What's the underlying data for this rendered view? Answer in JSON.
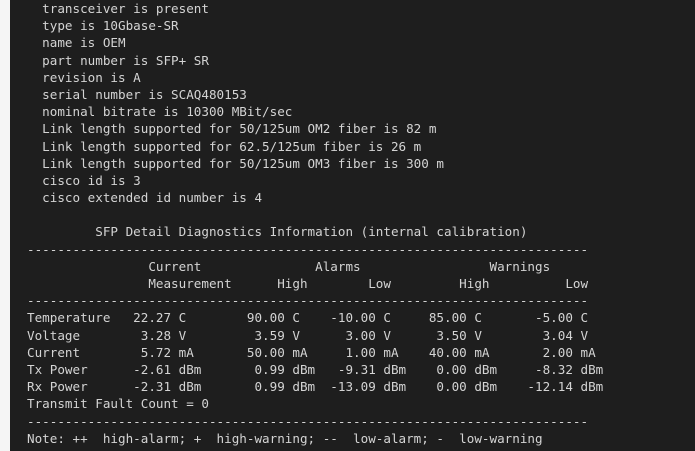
{
  "terminal": {
    "lines": [
      "  transceiver is present",
      "  type is 10Gbase-SR",
      "  name is OEM",
      "  part number is SFP+ SR",
      "  revision is A",
      "  serial number is SCAQ480153",
      "  nominal bitrate is 10300 MBit/sec",
      "  Link length supported for 50/125um OM2 fiber is 82 m",
      "  Link length supported for 62.5/125um fiber is 26 m",
      "  Link length supported for 50/125um OM3 fiber is 300 m",
      "  cisco id is 3",
      "  cisco extended id number is 4",
      "",
      "         SFP Detail Diagnostics Information (internal calibration)",
      "--------------------------------------------------------------------------",
      "                Current               Alarms                 Warnings",
      "                Measurement      High        Low         High          Low",
      "--------------------------------------------------------------------------",
      "Temperature   22.27 C        90.00 C    -10.00 C     85.00 C       -5.00 C",
      "Voltage        3.28 V         3.59 V      3.00 V      3.50 V        3.04 V",
      "Current        5.72 mA       50.00 mA     1.00 mA    40.00 mA       2.00 mA",
      "Tx Power      -2.61 dBm       0.99 dBm   -9.31 dBm    0.00 dBm     -8.32 dBm",
      "Rx Power      -2.31 dBm       0.99 dBm  -13.09 dBm    0.00 dBm    -12.14 dBm",
      "Transmit Fault Count = 0",
      "--------------------------------------------------------------------------",
      "Note: ++  high-alarm; +  high-warning; --  low-alarm; -  low-warning"
    ]
  }
}
